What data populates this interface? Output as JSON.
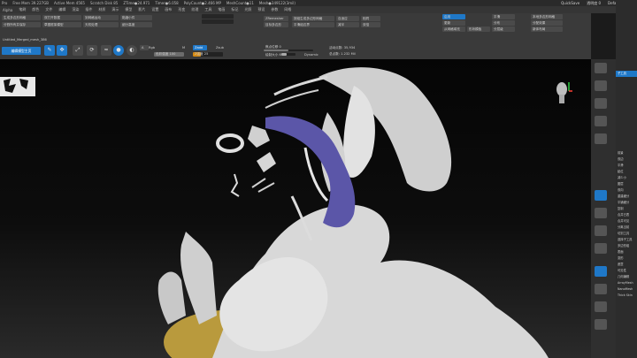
{
  "status": {
    "items": [
      "Pro",
      "Free Mem 39.227GB",
      "Active Mem 4565",
      "Scratch Disk 85",
      "ZTime●24.971",
      "Timer●6.058",
      "PolyCount●2.466 MP",
      "MeshCount●11",
      "Mesh●349122(3mil)"
    ],
    "quicksave": "QuickSave",
    "see_through": "透明度 0",
    "default_script": "DefaultZScript"
  },
  "menu": [
    "Alpha",
    "笔刷",
    "颜色",
    "文件",
    "编辑",
    "渲染",
    "插件",
    "材质",
    "演示",
    "模型",
    "影片",
    "设置",
    "画布",
    "形变",
    "纹理",
    "工具",
    "笔画",
    "标记",
    "光照",
    "预设",
    "参数",
    "网格"
  ],
  "toolbar": {
    "row1": [
      "生成多边形网格",
      "双打开数据",
      "到网格运动",
      "黏缩小件"
    ],
    "row2": [
      "分割所有并保存",
      "草图框架模型",
      "天机处理",
      "细分高度"
    ],
    "dynamesh": "ZRemesher",
    "group": "按组生成多边形网格",
    "polish": "平滑组边界",
    "target": "目标多边形",
    "adaptive": "自适应",
    "half": "减半",
    "same": "相同",
    "double": "双倍",
    "fields_right": [
      "启用",
      "更新",
      "从网格填充",
      "形状模板",
      "平滑",
      "分布",
      "分层级"
    ],
    "fields_right2": [
      "本地多边形网格",
      "分配效果",
      "新体布局"
    ],
    "doc_name": "Untitled_Merged_mesh_386",
    "edit_button": "编辑模型主页",
    "rgb": "Rgb",
    "m": "M",
    "z_add": "Zadd",
    "z_sub": "Zsub",
    "focal": "焦点位移 0",
    "draw_size": "绘制大小 64",
    "dynamic": "Dynamic",
    "active_points": "活动点数: 35,934",
    "total_points": "总点数: 1.232 Mil",
    "rgb_intensity": "色彩强度 100",
    "z_intensity": "Z强度 25",
    "a": "A"
  },
  "right_panel": {
    "items": [
      "子工具",
      "前景",
      "双边",
      "平滑",
      "起位",
      "减少小",
      "图层",
      "双向",
      "重建细分",
      "平铺细分",
      "复制",
      "合并已表",
      "合并可见",
      "分离当前",
      "切割工具",
      "选择子工具",
      "多边形组",
      "表面",
      "变形",
      "遮罩",
      "可见性",
      "几何编辑",
      "ArrayMesh",
      "NanoMesh",
      "Thick Skin"
    ],
    "tool_label": "子工具"
  },
  "colors": {
    "accent": "#1f78c8",
    "slider": "#d48a14",
    "panel": "#3a3a3a"
  },
  "icons": [
    "brush-icon",
    "move-icon",
    "scale-icon",
    "rotate-icon",
    "navigation-cube-icon",
    "material-sphere-icon"
  ]
}
